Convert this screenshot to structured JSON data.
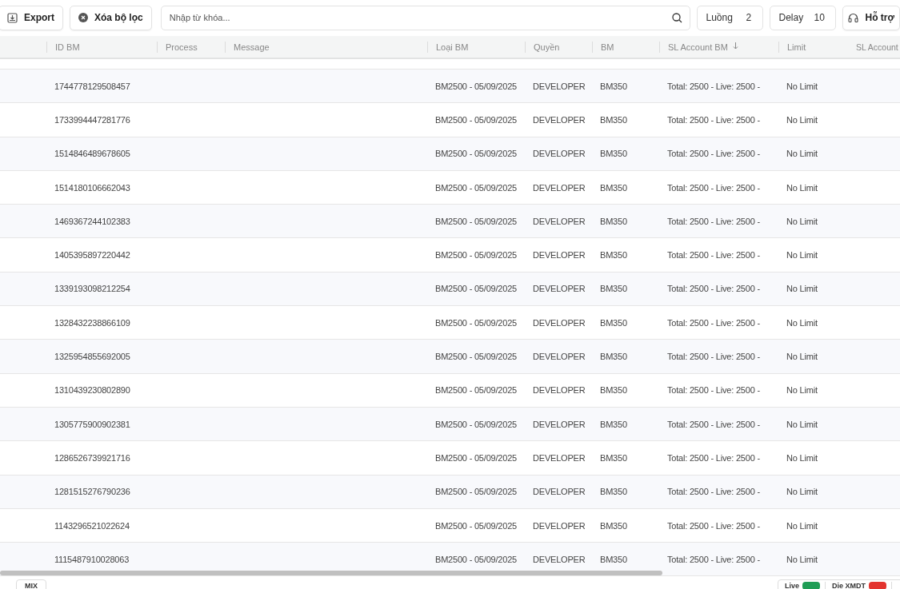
{
  "toolbar": {
    "export": "Export",
    "clear_filter": "Xóa bộ lọc",
    "search": {
      "placeholder": "Nhập từ khóa..."
    },
    "threads": {
      "label": "Luồng",
      "value": "2"
    },
    "delay": {
      "label": "Delay",
      "value": "10"
    },
    "support": "Hỗ trợ"
  },
  "table": {
    "columns": [
      {
        "label": "ID BM",
        "sorted": false
      },
      {
        "label": "Process",
        "sorted": false
      },
      {
        "label": "Message",
        "sorted": false
      },
      {
        "label": "Loại BM",
        "sorted": false
      },
      {
        "label": "Quyền",
        "sorted": false
      },
      {
        "label": "BM",
        "sorted": false
      },
      {
        "label": "SL Account BM",
        "sorted": true
      },
      {
        "label": "Limit",
        "sorted": false
      },
      {
        "label": "SL Account",
        "sorted": false
      }
    ],
    "rows": [
      {
        "id": "1744778129508457",
        "type": "BM2500 - 05/09/2025",
        "role": "DEVELOPER",
        "bm": "BM350",
        "accounts": "Total: 2500 - Live: 2500 -",
        "limit": "No Limit"
      },
      {
        "id": "1733994447281776",
        "type": "BM2500 - 05/09/2025",
        "role": "DEVELOPER",
        "bm": "BM350",
        "accounts": "Total: 2500 - Live: 2500 -",
        "limit": "No Limit"
      },
      {
        "id": "1514846489678605",
        "type": "BM2500 - 05/09/2025",
        "role": "DEVELOPER",
        "bm": "BM350",
        "accounts": "Total: 2500 - Live: 2500 -",
        "limit": "No Limit"
      },
      {
        "id": "1514180106662043",
        "type": "BM2500 - 05/09/2025",
        "role": "DEVELOPER",
        "bm": "BM350",
        "accounts": "Total: 2500 - Live: 2500 -",
        "limit": "No Limit"
      },
      {
        "id": "1469367244102383",
        "type": "BM2500 - 05/09/2025",
        "role": "DEVELOPER",
        "bm": "BM350",
        "accounts": "Total: 2500 - Live: 2500 -",
        "limit": "No Limit"
      },
      {
        "id": "1405395897220442",
        "type": "BM2500 - 05/09/2025",
        "role": "DEVELOPER",
        "bm": "BM350",
        "accounts": "Total: 2500 - Live: 2500 -",
        "limit": "No Limit"
      },
      {
        "id": "1339193098212254",
        "type": "BM2500 - 05/09/2025",
        "role": "DEVELOPER",
        "bm": "BM350",
        "accounts": "Total: 2500 - Live: 2500 -",
        "limit": "No Limit"
      },
      {
        "id": "1328432238866109",
        "type": "BM2500 - 05/09/2025",
        "role": "DEVELOPER",
        "bm": "BM350",
        "accounts": "Total: 2500 - Live: 2500 -",
        "limit": "No Limit"
      },
      {
        "id": "1325954855692005",
        "type": "BM2500 - 05/09/2025",
        "role": "DEVELOPER",
        "bm": "BM350",
        "accounts": "Total: 2500 - Live: 2500 -",
        "limit": "No Limit"
      },
      {
        "id": "1310439230802890",
        "type": "BM2500 - 05/09/2025",
        "role": "DEVELOPER",
        "bm": "BM350",
        "accounts": "Total: 2500 - Live: 2500 -",
        "limit": "No Limit"
      },
      {
        "id": "1305775900902381",
        "type": "BM2500 - 05/09/2025",
        "role": "DEVELOPER",
        "bm": "BM350",
        "accounts": "Total: 2500 - Live: 2500 -",
        "limit": "No Limit"
      },
      {
        "id": "1286526739921716",
        "type": "BM2500 - 05/09/2025",
        "role": "DEVELOPER",
        "bm": "BM350",
        "accounts": "Total: 2500 - Live: 2500 -",
        "limit": "No Limit"
      },
      {
        "id": "1281515276790236",
        "type": "BM2500 - 05/09/2025",
        "role": "DEVELOPER",
        "bm": "BM350",
        "accounts": "Total: 2500 - Live: 2500 -",
        "limit": "No Limit"
      },
      {
        "id": "1143296521022624",
        "type": "BM2500 - 05/09/2025",
        "role": "DEVELOPER",
        "bm": "BM350",
        "accounts": "Total: 2500 - Live: 2500 -",
        "limit": "No Limit"
      },
      {
        "id": "1115487910028063",
        "type": "BM2500 - 05/09/2025",
        "role": "DEVELOPER",
        "bm": "BM350",
        "accounts": "Total: 2500 - Live: 2500 -",
        "limit": "No Limit"
      }
    ]
  },
  "footer": {
    "mode": "MIX",
    "stats": [
      {
        "label": "Live",
        "color": "#1f9d55"
      },
      {
        "label": "Die XMDT",
        "color": "#e3342f"
      }
    ]
  }
}
